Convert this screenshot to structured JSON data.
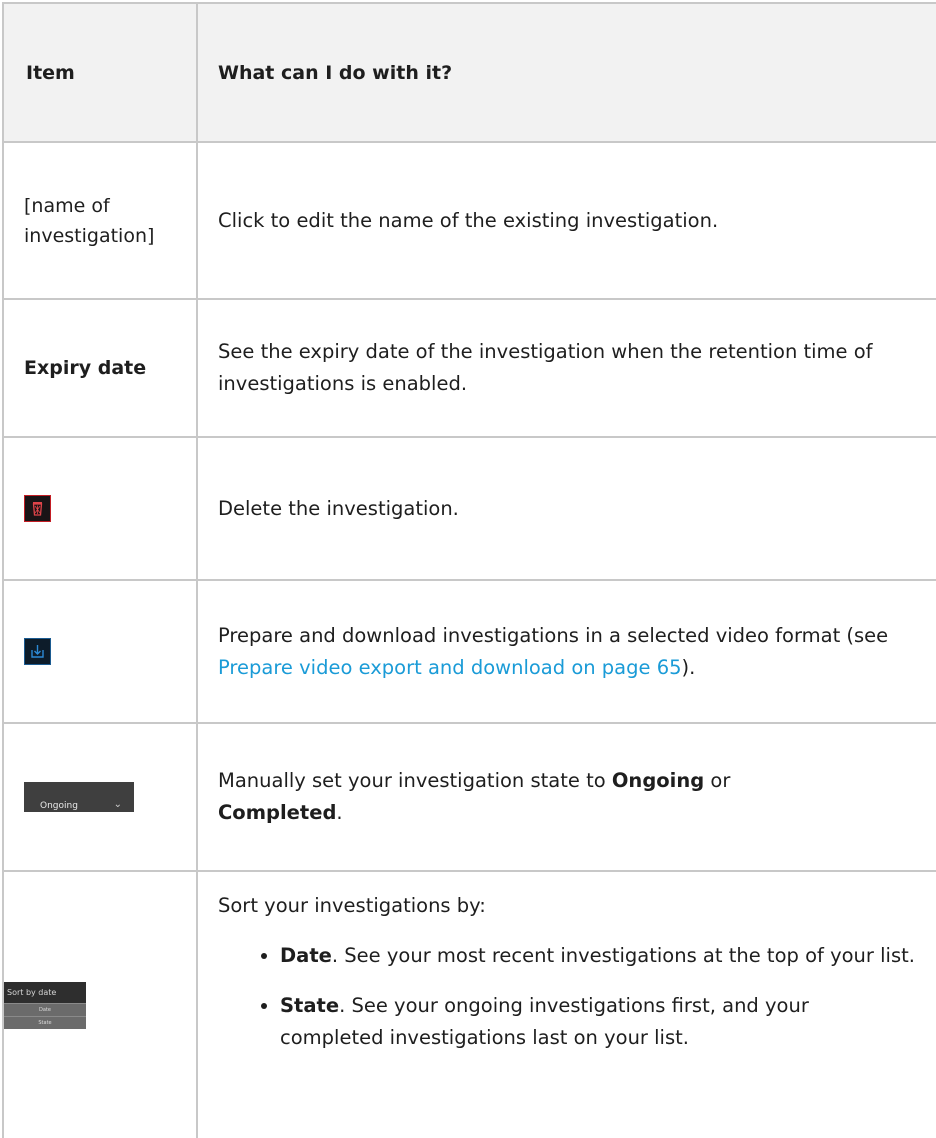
{
  "table": {
    "headers": [
      "Item",
      "What can I do with it?"
    ],
    "rows": [
      {
        "item": "[name of investigation]",
        "desc": "Click to edit the name of the existing investigation."
      },
      {
        "item": "Expiry date",
        "desc": "See the expiry date of the investigation when the retention time of investigations is enabled."
      },
      {
        "item_icon": "trash-icon",
        "desc": "Delete the investigation."
      },
      {
        "item_icon": "download-icon",
        "desc_pre": "Prepare and download investigations in a selected video format (see ",
        "desc_link": "Prepare video export and download on page 65",
        "desc_post": ")."
      },
      {
        "item_icon": "state-dropdown",
        "dropdown_label": "Ongoing",
        "desc_pre": "Manually set your investigation state to ",
        "desc_b1": "Ongoing",
        "desc_mid": " or ",
        "desc_b2": "Completed",
        "desc_post": "."
      },
      {
        "item_icon": "sort-dropdown",
        "sort_label": "Sort by date",
        "sort_options": [
          "Date",
          "State"
        ],
        "desc_intro": "Sort your investigations by:",
        "bullets": [
          {
            "term": "Date",
            "text": ". See your most recent investigations at the top of your list."
          },
          {
            "term": "State",
            "text": ". See your ongoing investigations first, and your completed investigations last on your list."
          }
        ]
      }
    ]
  },
  "colors": {
    "header_bg": "#f2f2f2",
    "border": "#c8c8c8",
    "link": "#1a9bd7",
    "trash_accent": "#c31d24",
    "download_accent": "#1b5b91"
  }
}
